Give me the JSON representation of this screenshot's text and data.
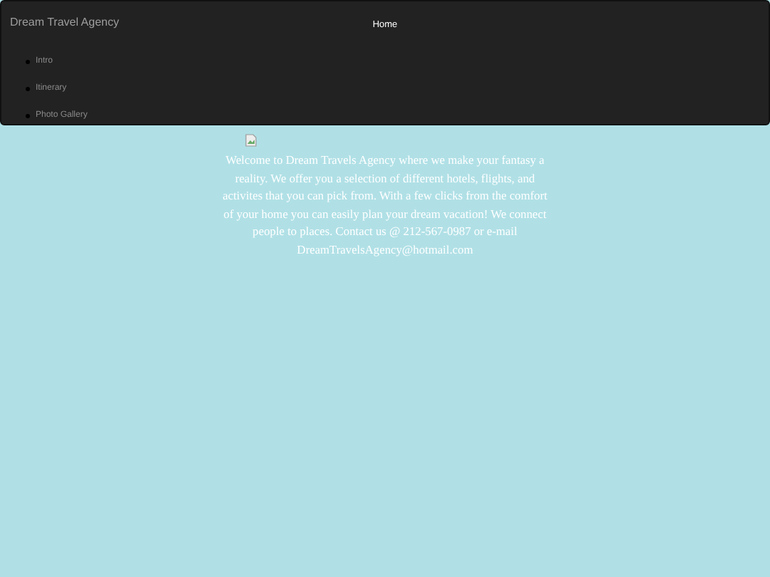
{
  "navbar": {
    "brand": "Dream Travel Agency",
    "links": [
      {
        "label": "Home",
        "selected": true
      }
    ],
    "menu": [
      {
        "label": "Intro"
      },
      {
        "label": "Itinerary"
      },
      {
        "label": "Photo Gallery"
      }
    ]
  },
  "content": {
    "image": {
      "kind": "broken-image"
    },
    "text": "Welcome to Dream Travels Agency where we make your fantasy a reality. We offer you a selection of different hotels, flights, and activites that you can pick from. With a few clicks from the comfort of your home you can easily plan your dream vacation! We connect people to places. Contact us @ 212-567-0987 or e-mail DreamTravelsAgency@hotmail.com"
  }
}
